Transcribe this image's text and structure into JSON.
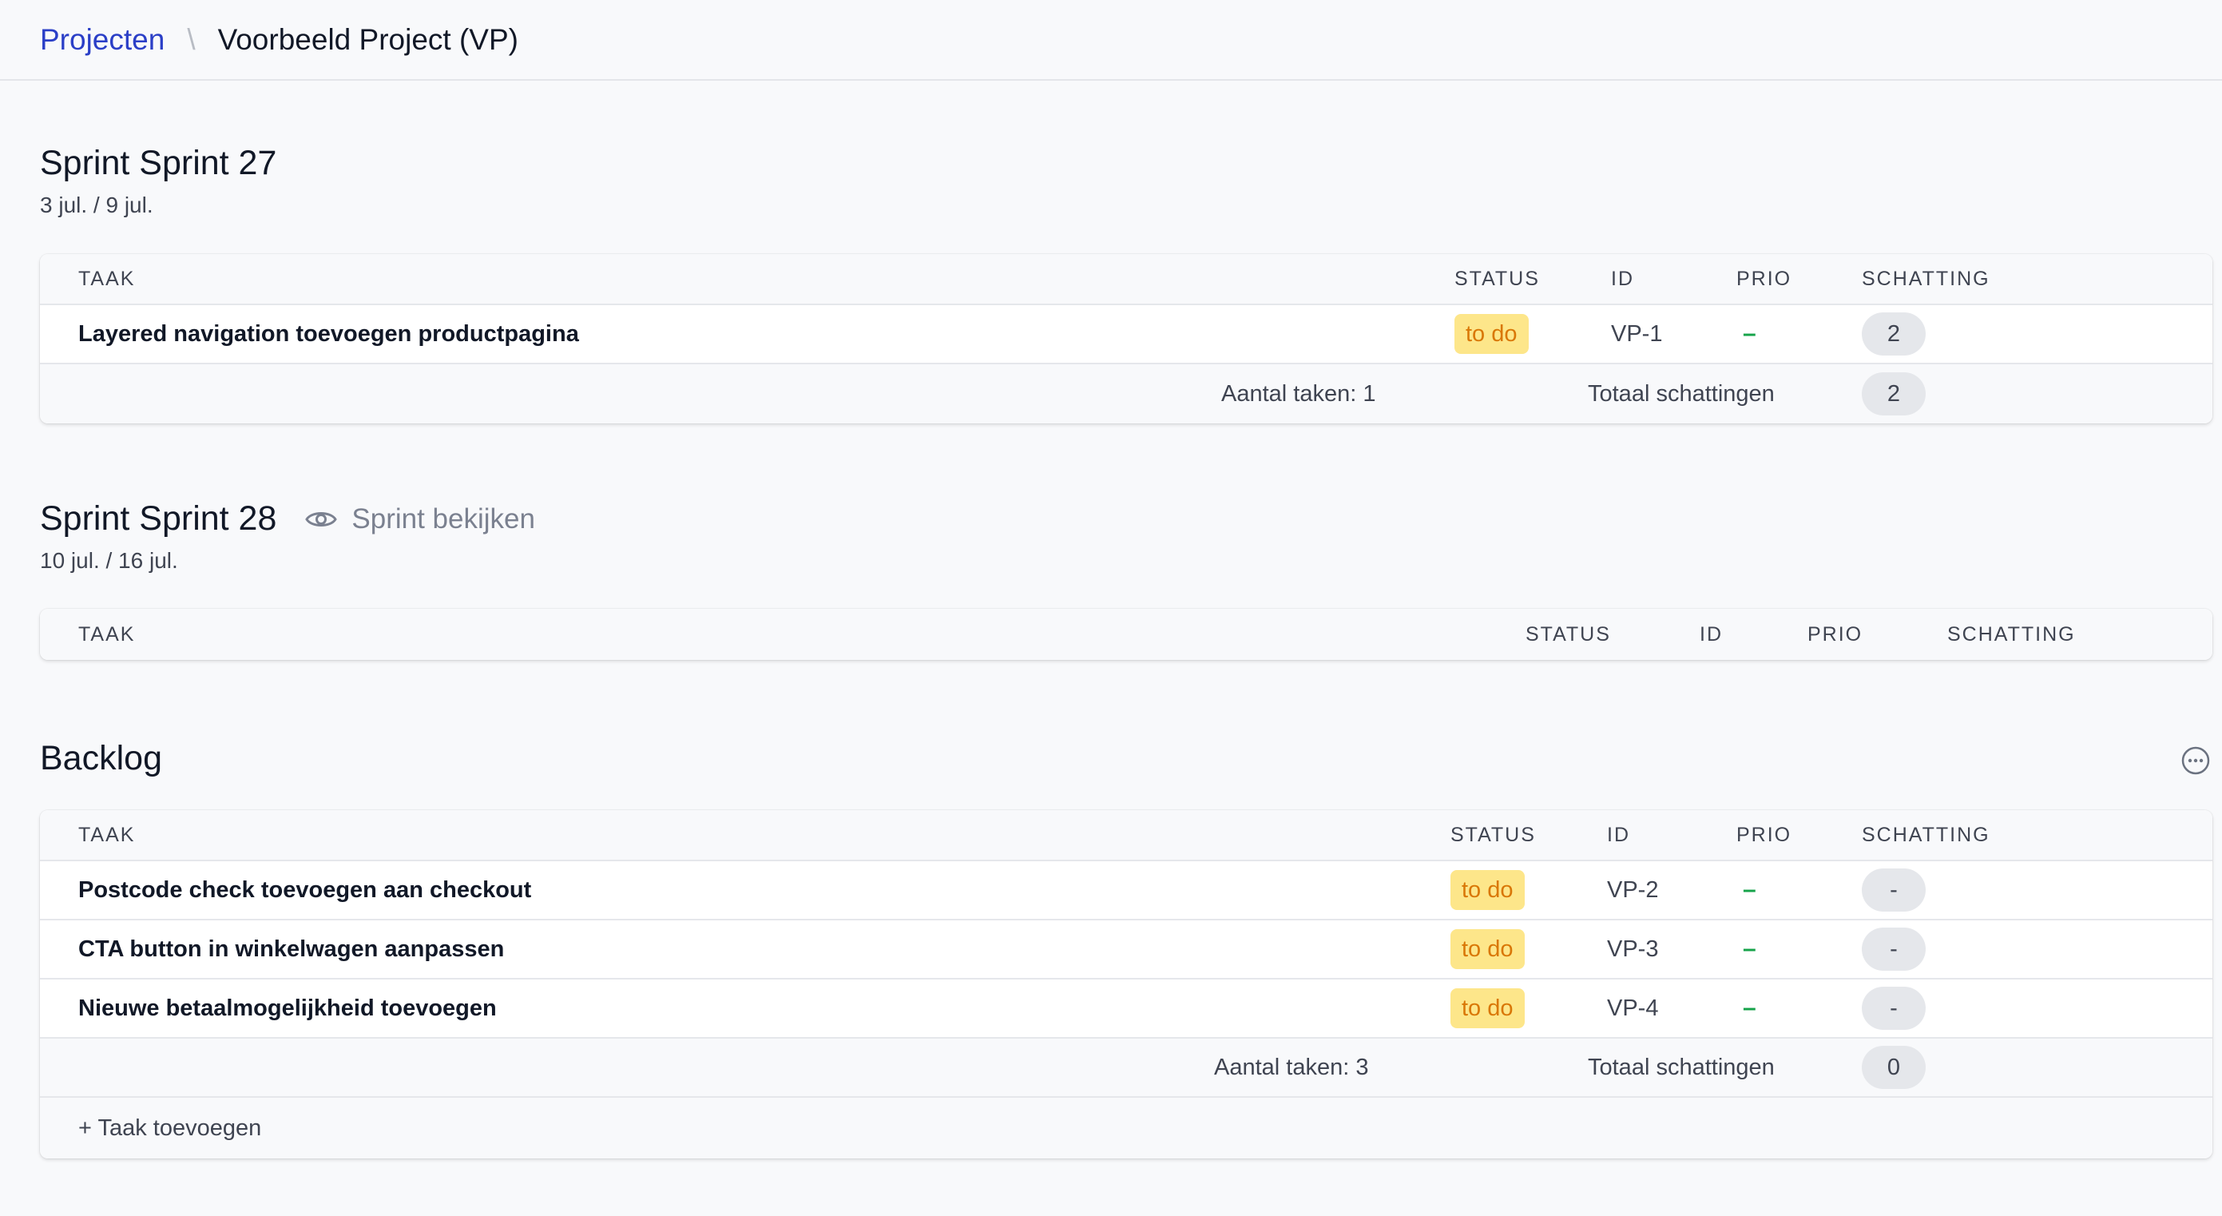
{
  "breadcrumb": {
    "parent": "Projecten",
    "separator": "\\",
    "current": "Voorbeeld Project (VP)"
  },
  "columns": {
    "task": "TAAK",
    "status": "STATUS",
    "id": "ID",
    "prio": "PRIO",
    "estimate": "SCHATTING"
  },
  "sprint27": {
    "title": "Sprint Sprint 27",
    "dates": "3 jul. / 9 jul.",
    "rows": [
      {
        "task": "Layered navigation toevoegen productpagina",
        "status": "to do",
        "id": "VP-1",
        "prio": "–",
        "estimate": "2"
      }
    ],
    "footer": {
      "count": "Aantal taken: 1",
      "total_label": "Totaal schattingen",
      "total": "2"
    }
  },
  "sprint28": {
    "title": "Sprint Sprint 28",
    "view_label": "Sprint bekijken",
    "dates": "10 jul. / 16 jul."
  },
  "backlog": {
    "title": "Backlog",
    "rows": [
      {
        "task": "Postcode check toevoegen aan checkout",
        "status": "to do",
        "id": "VP-2",
        "prio": "–",
        "estimate": "-"
      },
      {
        "task": "CTA button in winkelwagen aanpassen",
        "status": "to do",
        "id": "VP-3",
        "prio": "–",
        "estimate": "-"
      },
      {
        "task": "Nieuwe betaalmogelijkheid toevoegen",
        "status": "to do",
        "id": "VP-4",
        "prio": "–",
        "estimate": "-"
      }
    ],
    "footer": {
      "count": "Aantal taken: 3",
      "total_label": "Totaal schattingen",
      "total": "0"
    },
    "add_task": "+ Taak toevoegen"
  },
  "colors": {
    "link": "#2b3fc7",
    "status_todo_bg": "#fde68a",
    "status_todo_text": "#d97706",
    "prio": "#16a34a"
  }
}
